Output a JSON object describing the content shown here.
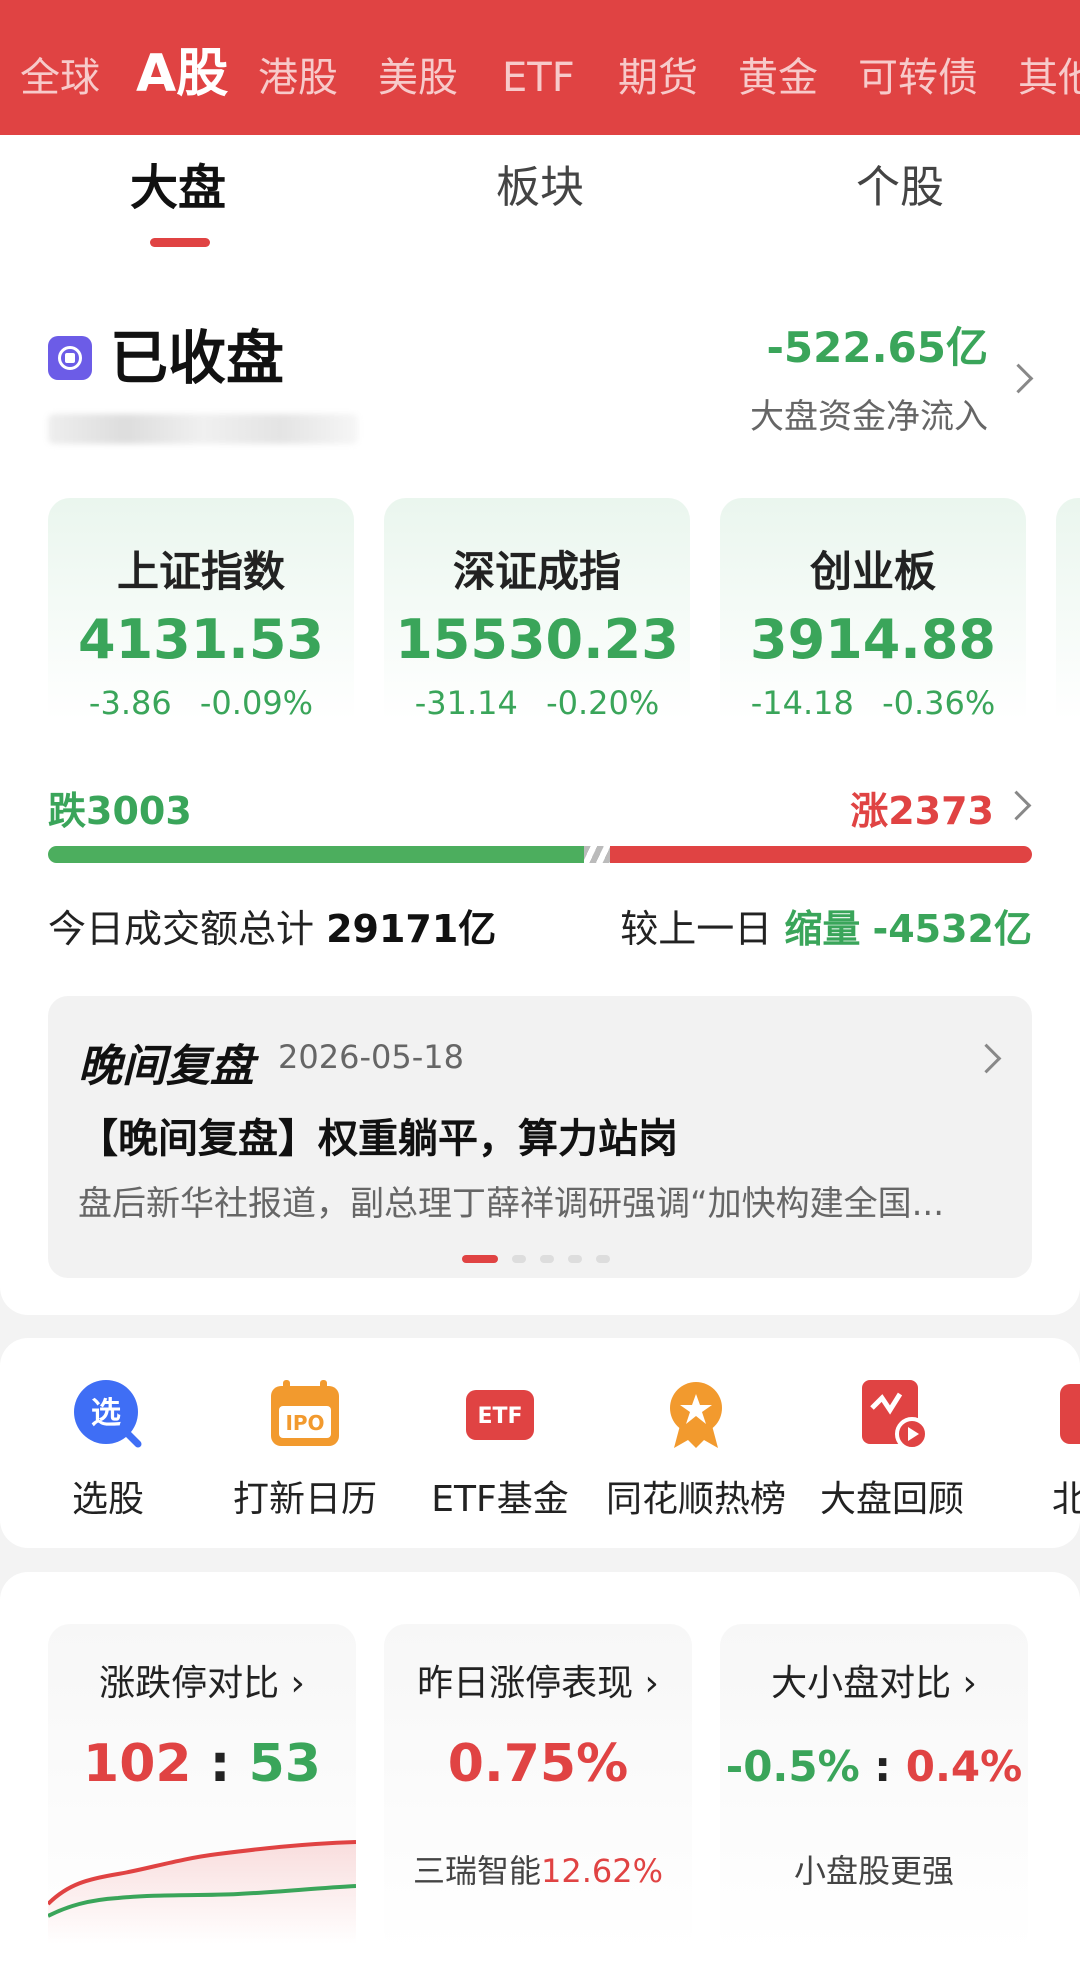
{
  "market_tabs": [
    "全球",
    "A股",
    "港股",
    "美股",
    "ETF",
    "期货",
    "黄金",
    "可转债",
    "其他"
  ],
  "sub_tabs": [
    "大盘",
    "板块",
    "个股"
  ],
  "status": {
    "label": "已收盘"
  },
  "fund_flow": {
    "value": "-522.65亿",
    "label": "大盘资金净流入"
  },
  "indices": [
    {
      "name": "上证指数",
      "price": "4131.53",
      "change": "-3.86",
      "pct": "-0.09%"
    },
    {
      "name": "深证成指",
      "price": "15530.23",
      "change": "-31.14",
      "pct": "-0.20%"
    },
    {
      "name": "创业板",
      "price": "3914.88",
      "change": "-14.18",
      "pct": "-0.36%"
    }
  ],
  "breadth": {
    "fall": "跌3003",
    "rise": "涨2373",
    "fall_ratio": 0.559
  },
  "turnover": {
    "label": "今日成交额总计",
    "value": "29171亿",
    "compare_label": "较上一日",
    "compare_tag": "缩量",
    "compare_value": "-4532亿"
  },
  "review": {
    "title": "晚间复盘",
    "date": "2026-05-18",
    "headline": "【晚间复盘】权重躺平，算力站岗",
    "summary": "盘后新华社报道，副总理丁薛祥调研强调“加快构建全国..."
  },
  "shortcuts": [
    {
      "label": "选股",
      "icon": "search-stock-icon"
    },
    {
      "label": "打新日历",
      "icon": "ipo-calendar-icon"
    },
    {
      "label": "ETF基金",
      "icon": "etf-icon"
    },
    {
      "label": "同花顺热榜",
      "icon": "hot-list-icon"
    },
    {
      "label": "大盘回顾",
      "icon": "market-replay-icon"
    },
    {
      "label": "北交",
      "icon": "bj-icon"
    }
  ],
  "stats": [
    {
      "title": "涨跌停对比",
      "left": "102",
      "right": "53"
    },
    {
      "title": "昨日涨停表现",
      "value": "0.75%",
      "sub_name": "三瑞智能",
      "sub_value": "12.62%"
    },
    {
      "title": "大小盘对比",
      "left": "-0.5%",
      "right": "0.4%",
      "sub": "小盘股更强"
    }
  ],
  "colors": {
    "red": "#e04343",
    "green": "#3aa55a",
    "accent": "#6c5ce7"
  }
}
